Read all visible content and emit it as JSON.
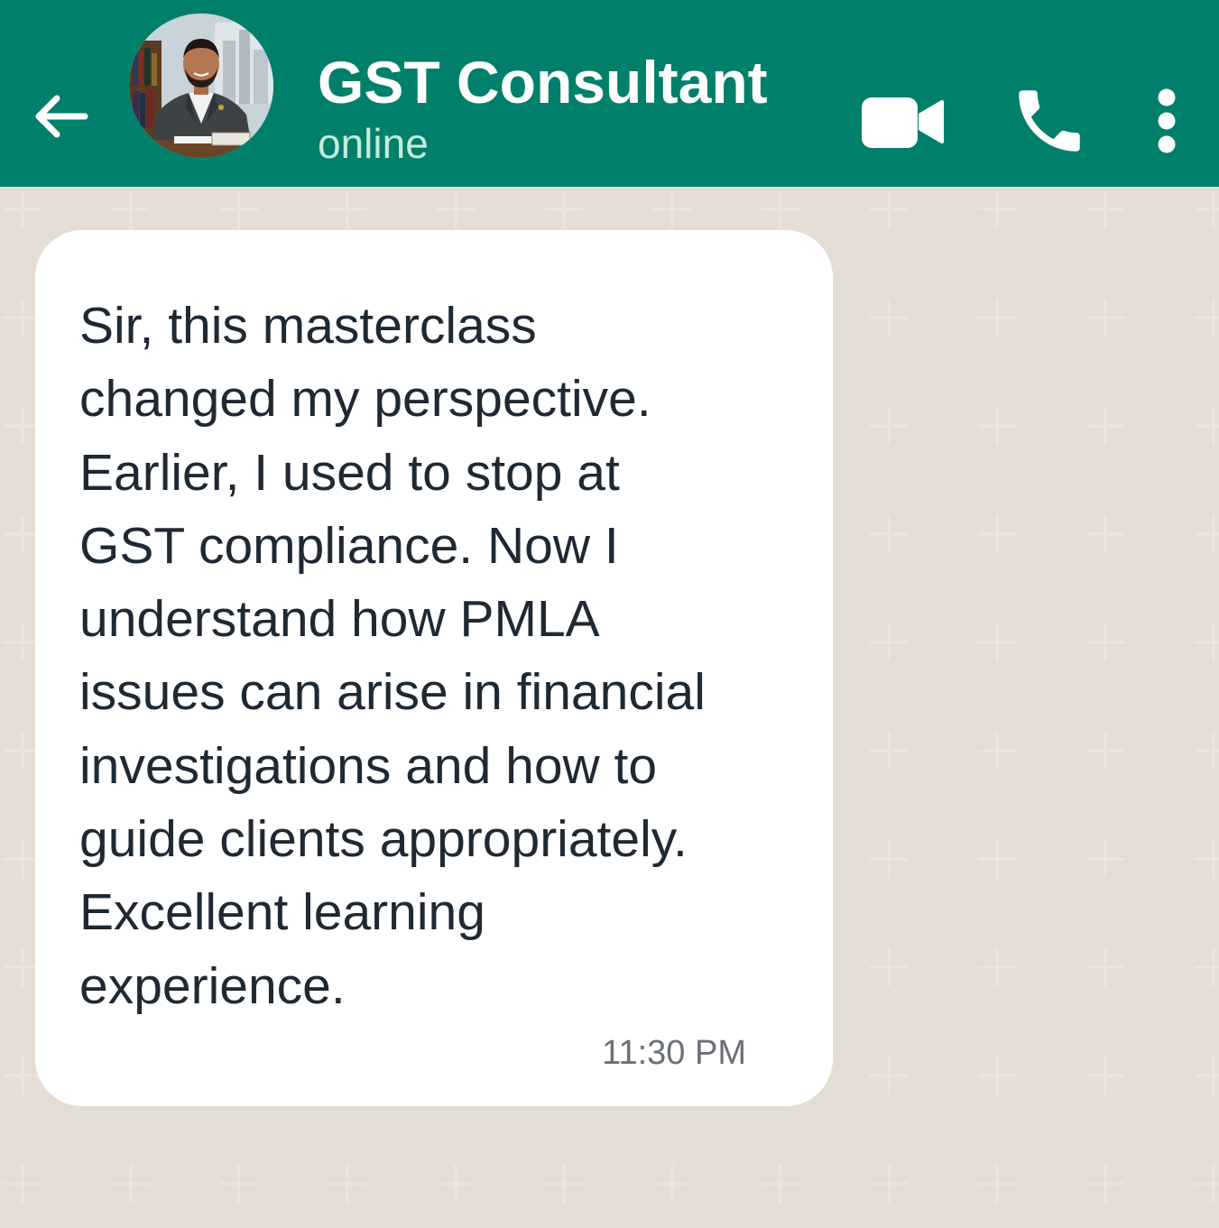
{
  "header": {
    "contact_name": "GST Consultant",
    "status": "online",
    "colors": {
      "bar": "#00806a",
      "name": "#ffffff",
      "status": "#c5ecdd"
    },
    "icons": {
      "back": "arrow-left-icon",
      "avatar": "contact-avatar",
      "video": "video-camera-icon",
      "call": "phone-icon",
      "menu": "more-vertical-icon"
    }
  },
  "chat": {
    "background_color": "#e4ddd3",
    "messages": [
      {
        "direction": "incoming",
        "text": "Sir, this masterclass\nchanged my perspective.\nEarlier, I used to stop at\nGST compliance. Now I\nunderstand how PMLA\nissues can arise in financial\ninvestigations and how to\nguide clients appropriately.\nExcellent learning\nexperience.",
        "time": "11:30 PM"
      }
    ]
  }
}
